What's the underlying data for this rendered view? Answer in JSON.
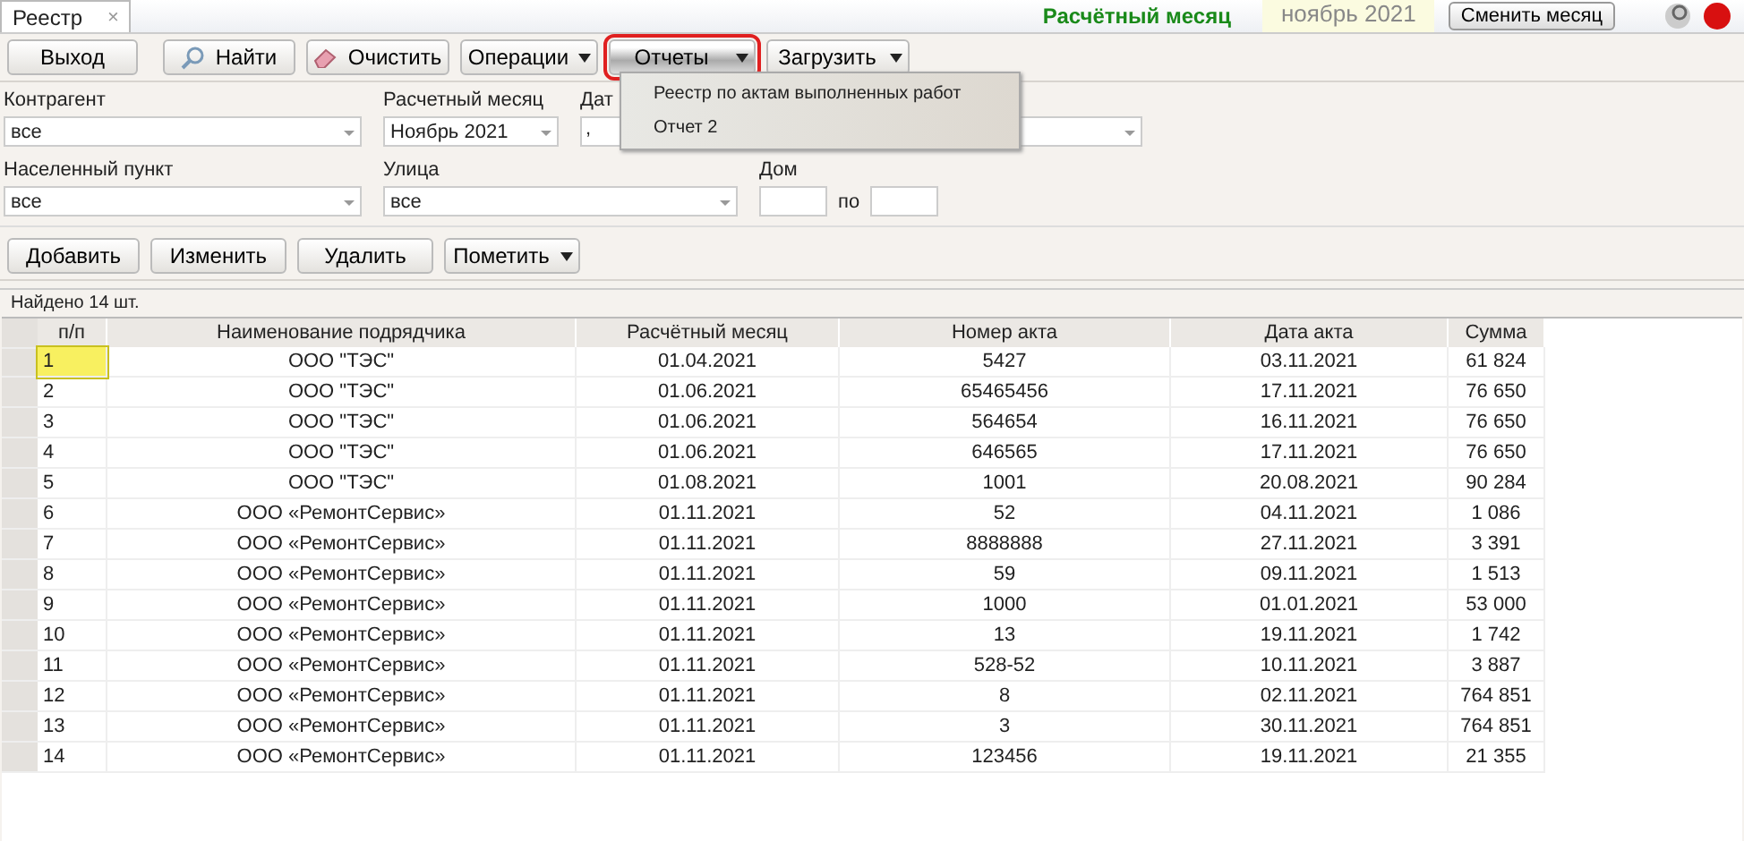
{
  "tab": {
    "label": "Реестр",
    "close": "×"
  },
  "period": {
    "label": "Расчётный месяц",
    "value": "ноябрь 2021",
    "button": "Сменить месяц"
  },
  "toolbar": [
    {
      "label": "Выход",
      "kind": "plain",
      "selected": false
    },
    {
      "label": "Найти",
      "kind": "find",
      "selected": false
    },
    {
      "label": "Очистить",
      "kind": "clear",
      "selected": false
    },
    {
      "label": "Операции",
      "kind": "split",
      "selected": false
    },
    {
      "label": "Отчеты",
      "kind": "split",
      "selected": true
    },
    {
      "label": "Загрузить",
      "kind": "split",
      "selected": false
    }
  ],
  "menu": [
    "Реестр по актам выполненных работ",
    "Отчет 2"
  ],
  "filters": [
    {
      "label": "Контрагент",
      "value": "все",
      "kind": "combo"
    },
    {
      "label": "Расчетный месяц",
      "value": "Ноябрь 2021",
      "kind": "combo"
    },
    {
      "label": "Дат",
      "value": ",",
      "kind": "date"
    },
    {
      "label": "Населенный пункт",
      "value": "все",
      "kind": "combo"
    },
    {
      "label": "Улица",
      "value": "все",
      "kind": "combo"
    },
    {
      "label": "Дом",
      "to": "по",
      "kind": "range"
    }
  ],
  "actions": [
    {
      "label": "Добавить",
      "kind": "plain"
    },
    {
      "label": "Изменить",
      "kind": "plain"
    },
    {
      "label": "Удалить",
      "kind": "plain"
    },
    {
      "label": "Пометить",
      "kind": "split"
    }
  ],
  "found": "Найдено 14 шт.",
  "table": {
    "columns": [
      "п/п",
      "Наименование подрядчика",
      "Расчётный месяц",
      "Номер акта",
      "Дата акта",
      "Сумма"
    ],
    "rows": [
      {
        "selected": true,
        "cells": [
          "1",
          "ООО \"ТЭС\"",
          "01.04.2021",
          "5427",
          "03.11.2021",
          "61 824"
        ]
      },
      {
        "selected": false,
        "cells": [
          "2",
          "ООО \"ТЭС\"",
          "01.06.2021",
          "65465456",
          "17.11.2021",
          "76 650"
        ]
      },
      {
        "selected": false,
        "cells": [
          "3",
          "ООО \"ТЭС\"",
          "01.06.2021",
          "564654",
          "16.11.2021",
          "76 650"
        ]
      },
      {
        "selected": false,
        "cells": [
          "4",
          "ООО \"ТЭС\"",
          "01.06.2021",
          "646565",
          "17.11.2021",
          "76 650"
        ]
      },
      {
        "selected": false,
        "cells": [
          "5",
          "ООО \"ТЭС\"",
          "01.08.2021",
          "1001",
          "20.08.2021",
          "90 284"
        ]
      },
      {
        "selected": false,
        "cells": [
          "6",
          "ООО  «РемонтСервис»",
          "01.11.2021",
          "52",
          "04.11.2021",
          "1 086"
        ]
      },
      {
        "selected": false,
        "cells": [
          "7",
          "ООО  «РемонтСервис»",
          "01.11.2021",
          "8888888",
          "27.11.2021",
          "3 391"
        ]
      },
      {
        "selected": false,
        "cells": [
          "8",
          "ООО  «РемонтСервис»",
          "01.11.2021",
          "59",
          "09.11.2021",
          "1 513"
        ]
      },
      {
        "selected": false,
        "cells": [
          "9",
          "ООО  «РемонтСервис»",
          "01.11.2021",
          "1000",
          "01.01.2021",
          "53 000"
        ]
      },
      {
        "selected": false,
        "cells": [
          "10",
          "ООО  «РемонтСервис»",
          "01.11.2021",
          "13",
          "19.11.2021",
          "1 742"
        ]
      },
      {
        "selected": false,
        "cells": [
          "11",
          "ООО  «РемонтСервис»",
          "01.11.2021",
          "528-52",
          "10.11.2021",
          "3 887"
        ]
      },
      {
        "selected": false,
        "cells": [
          "12",
          "ООО  «РемонтСервис»",
          "01.11.2021",
          "8",
          "02.11.2021",
          "764 851"
        ]
      },
      {
        "selected": false,
        "cells": [
          "13",
          "ООО  «РемонтСервис»",
          "01.11.2021",
          "3",
          "30.11.2021",
          "764 851"
        ]
      },
      {
        "selected": false,
        "cells": [
          "14",
          "ООО  «РемонтСервис»",
          "01.11.2021",
          "123456",
          "19.11.2021",
          "21 355"
        ]
      }
    ]
  }
}
